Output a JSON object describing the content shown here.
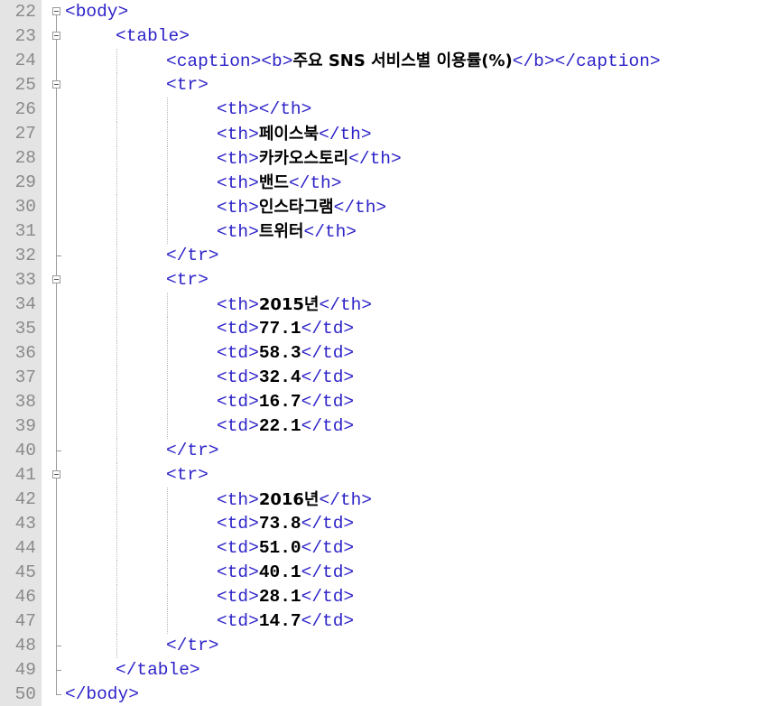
{
  "lines": [
    {
      "num": "22",
      "open": "<body>"
    },
    {
      "num": "23",
      "open": "<table>"
    },
    {
      "num": "24",
      "open": "<caption><b>",
      "text": "주요 SNS 서비스별 이용률(%)",
      "close": "</b></caption>"
    },
    {
      "num": "25",
      "open": "<tr>"
    },
    {
      "num": "26",
      "open": "<th></th>"
    },
    {
      "num": "27",
      "open": "<th>",
      "text": "페이스북",
      "close": "</th>"
    },
    {
      "num": "28",
      "open": "<th>",
      "text": "카카오스토리",
      "close": "</th>"
    },
    {
      "num": "29",
      "open": "<th>",
      "text": "밴드",
      "close": "</th>"
    },
    {
      "num": "30",
      "open": "<th>",
      "text": "인스타그램",
      "close": "</th>"
    },
    {
      "num": "31",
      "open": "<th>",
      "text": "트위터",
      "close": "</th>"
    },
    {
      "num": "32",
      "open": "</tr>"
    },
    {
      "num": "33",
      "open": "<tr>"
    },
    {
      "num": "34",
      "open": "<th>",
      "text": "2015년",
      "close": "</th>"
    },
    {
      "num": "35",
      "open": "<td>",
      "text": "77.1",
      "close": "</td>"
    },
    {
      "num": "36",
      "open": "<td>",
      "text": "58.3",
      "close": "</td>"
    },
    {
      "num": "37",
      "open": "<td>",
      "text": "32.4",
      "close": "</td>"
    },
    {
      "num": "38",
      "open": "<td>",
      "text": "16.7",
      "close": "</td>"
    },
    {
      "num": "39",
      "open": "<td>",
      "text": "22.1",
      "close": "</td>"
    },
    {
      "num": "40",
      "open": "</tr>"
    },
    {
      "num": "41",
      "open": "<tr>"
    },
    {
      "num": "42",
      "open": "<th>",
      "text": "2016년",
      "close": "</th>"
    },
    {
      "num": "43",
      "open": "<td>",
      "text": "73.8",
      "close": "</td>"
    },
    {
      "num": "44",
      "open": "<td>",
      "text": "51.0",
      "close": "</td>"
    },
    {
      "num": "45",
      "open": "<td>",
      "text": "40.1",
      "close": "</td>"
    },
    {
      "num": "46",
      "open": "<td>",
      "text": "28.1",
      "close": "</td>"
    },
    {
      "num": "47",
      "open": "<td>",
      "text": "14.7",
      "close": "</td>"
    },
    {
      "num": "48",
      "open": "</tr>"
    },
    {
      "num": "49",
      "open": "</table>"
    },
    {
      "num": "50",
      "open": "</body>"
    }
  ],
  "colors": {
    "tag": "#2d23c8",
    "text": "#000000",
    "line_number": "#8a8a8a",
    "gutter": "#e4e4e4"
  }
}
